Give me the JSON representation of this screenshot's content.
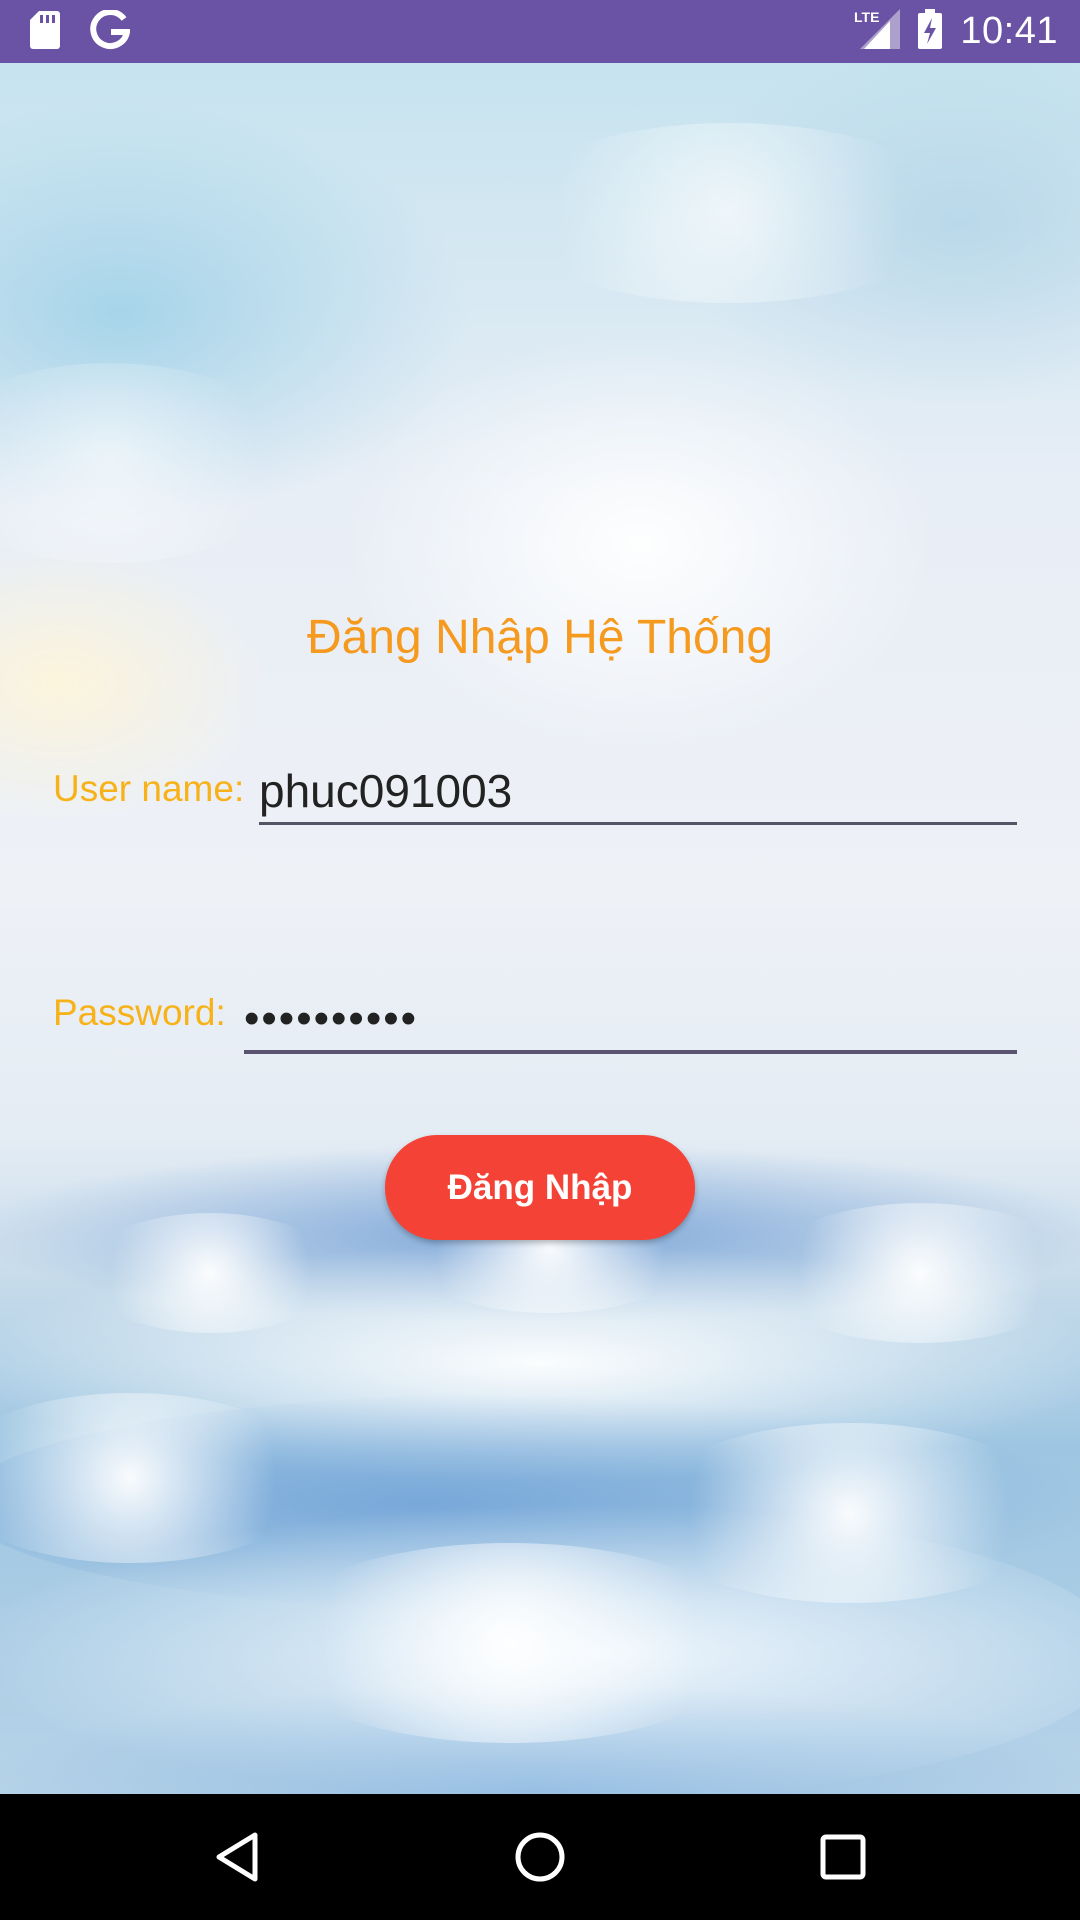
{
  "status_bar": {
    "time": "10:41",
    "network": "LTE",
    "icons": [
      "sd-card-icon",
      "google-icon",
      "lte-signal-icon",
      "battery-charging-icon"
    ]
  },
  "login": {
    "title": "Đăng Nhập Hệ Thống",
    "username_label": "User name:",
    "username_value": "phuc091003",
    "password_label": "Password:",
    "password_value": "••••••••••",
    "submit_label": "Đăng Nhập"
  },
  "colors": {
    "status_bar": "#6a52a5",
    "title": "#f59a1f",
    "labels": "#f7b21a",
    "button": "#f44336"
  },
  "nav_bar": {
    "icons": [
      "back-icon",
      "home-icon",
      "recents-icon"
    ]
  }
}
